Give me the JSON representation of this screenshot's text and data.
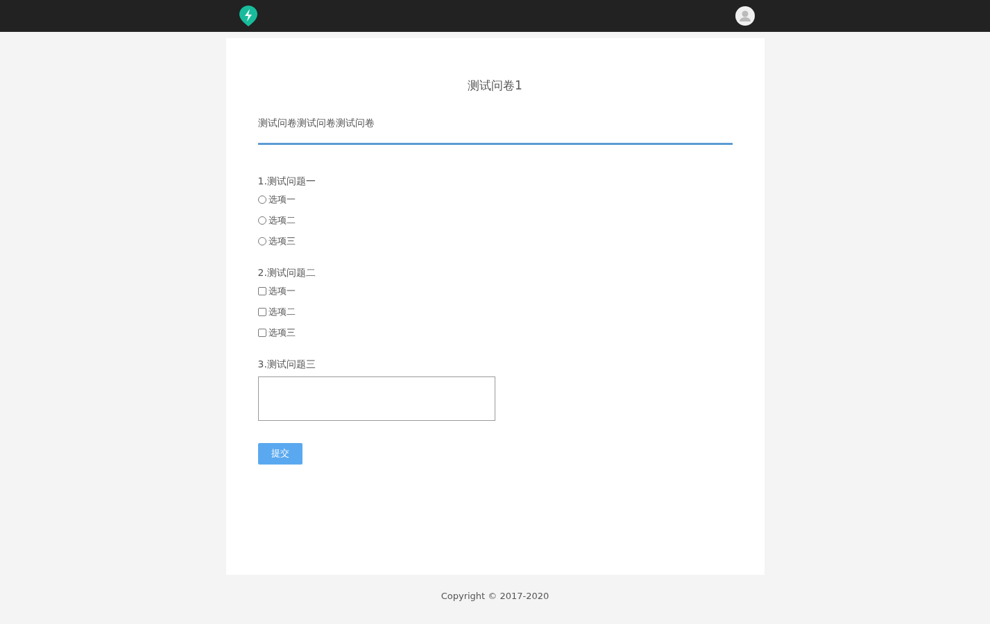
{
  "title": "测试问卷1",
  "description": "测试问卷测试问卷测试问卷",
  "questions": [
    {
      "kind": "radio",
      "label": "1.测试问题一",
      "options": [
        {
          "label": "选项一",
          "checked": false
        },
        {
          "label": "选项二",
          "checked": false
        },
        {
          "label": "选项三",
          "checked": false
        }
      ]
    },
    {
      "kind": "checkbox",
      "label": "2.测试问题二",
      "options": [
        {
          "label": "选项一",
          "checked": false
        },
        {
          "label": "选项二",
          "checked": false
        },
        {
          "label": "选项三",
          "checked": false
        }
      ]
    },
    {
      "kind": "text",
      "label": "3.测试问题三"
    }
  ],
  "submit": "提交",
  "footer": "Copyright © 2017-2020"
}
